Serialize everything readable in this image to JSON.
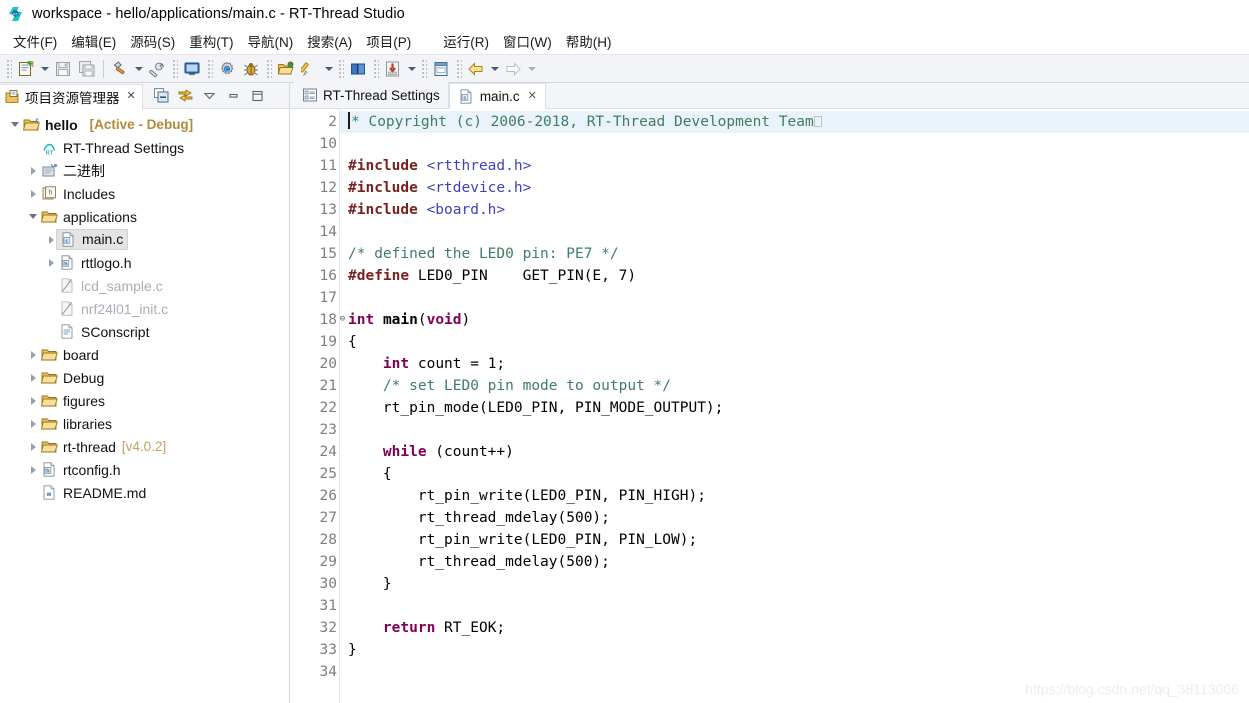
{
  "window": {
    "title": "workspace - hello/applications/main.c - RT-Thread Studio",
    "app_icon": "rt-thread-logo-icon"
  },
  "menubar": {
    "items": [
      {
        "label": "文件(F)",
        "name": "menu-file"
      },
      {
        "label": "编辑(E)",
        "name": "menu-edit"
      },
      {
        "label": "源码(S)",
        "name": "menu-source"
      },
      {
        "label": "重构(T)",
        "name": "menu-refactor"
      },
      {
        "label": "导航(N)",
        "name": "menu-navigate"
      },
      {
        "label": "搜索(A)",
        "name": "menu-search"
      },
      {
        "label": "项目(P)",
        "name": "menu-project"
      },
      {
        "label": "运行(R)",
        "name": "menu-run"
      },
      {
        "label": "窗口(W)",
        "name": "menu-window"
      },
      {
        "label": "帮助(H)",
        "name": "menu-help"
      }
    ]
  },
  "toolbar": {
    "buttons": [
      "new-file-icon",
      "save-icon",
      "save-all-icon",
      "build-hammer-icon",
      "wrench-icon",
      "console-icon",
      "settings-gear-icon",
      "debug-bug-icon",
      "open-folder-icon",
      "pencil-icon",
      "book-icon",
      "import-icon",
      "terminal-icon",
      "back-arrow-icon",
      "forward-arrow-icon"
    ]
  },
  "explorer": {
    "tab_label": "项目资源管理器",
    "tab_icon": "project-explorer-icon",
    "tab_close": "✕",
    "actions": [
      "collapse-all-icon",
      "link-with-editor-icon",
      "view-menu-icon",
      "minimize-icon",
      "maximize-icon"
    ],
    "tree": [
      {
        "label": "hello",
        "suffix": "[Active - Debug]",
        "icon": "c-project-folder-icon",
        "twist": "open",
        "depth": 0,
        "bold": true,
        "name": "tree-item-hello"
      },
      {
        "label": "RT-Thread Settings",
        "suffix": "",
        "icon": "rt-settings-icon",
        "twist": "none",
        "depth": 1,
        "bold": false,
        "name": "tree-item-rt-thread-settings"
      },
      {
        "label": "二进制",
        "suffix": "",
        "icon": "binaries-icon",
        "twist": "closed",
        "depth": 1,
        "bold": false,
        "name": "tree-item-binaries"
      },
      {
        "label": "Includes",
        "suffix": "",
        "icon": "includes-icon",
        "twist": "closed",
        "depth": 1,
        "bold": false,
        "name": "tree-item-includes"
      },
      {
        "label": "applications",
        "suffix": "",
        "icon": "folder-icon",
        "twist": "open",
        "depth": 1,
        "bold": false,
        "name": "tree-item-applications"
      },
      {
        "label": "main.c",
        "suffix": "",
        "icon": "c-file-icon",
        "twist": "closed",
        "depth": 2,
        "bold": false,
        "selected": true,
        "name": "tree-item-main-c"
      },
      {
        "label": "rttlogo.h",
        "suffix": "",
        "icon": "h-file-icon",
        "twist": "closed",
        "depth": 2,
        "bold": false,
        "name": "tree-item-rttlogo-h"
      },
      {
        "label": "lcd_sample.c",
        "suffix": "",
        "icon": "excluded-file-icon",
        "twist": "none",
        "depth": 2,
        "bold": false,
        "muted": true,
        "name": "tree-item-lcd-sample-c"
      },
      {
        "label": "nrf24l01_init.c",
        "suffix": "",
        "icon": "excluded-file-icon",
        "twist": "none",
        "depth": 2,
        "bold": false,
        "muted": true,
        "name": "tree-item-nrf24l01-init-c"
      },
      {
        "label": "SConscript",
        "suffix": "",
        "icon": "text-file-icon",
        "twist": "none",
        "depth": 2,
        "bold": false,
        "name": "tree-item-sconscript"
      },
      {
        "label": "board",
        "suffix": "",
        "icon": "folder-icon",
        "twist": "closed",
        "depth": 1,
        "bold": false,
        "name": "tree-item-board"
      },
      {
        "label": "Debug",
        "suffix": "",
        "icon": "folder-icon",
        "twist": "closed",
        "depth": 1,
        "bold": false,
        "name": "tree-item-debug"
      },
      {
        "label": "figures",
        "suffix": "",
        "icon": "folder-icon",
        "twist": "closed",
        "depth": 1,
        "bold": false,
        "name": "tree-item-figures"
      },
      {
        "label": "libraries",
        "suffix": "",
        "icon": "folder-icon",
        "twist": "closed",
        "depth": 1,
        "bold": false,
        "name": "tree-item-libraries"
      },
      {
        "label": "rt-thread",
        "suffix": "[v4.0.2]",
        "suffix_light": true,
        "icon": "folder-icon",
        "twist": "closed",
        "depth": 1,
        "bold": false,
        "name": "tree-item-rt-thread"
      },
      {
        "label": "rtconfig.h",
        "suffix": "",
        "icon": "h-file-icon",
        "twist": "closed",
        "depth": 1,
        "bold": false,
        "name": "tree-item-rtconfig-h"
      },
      {
        "label": "README.md",
        "suffix": "",
        "icon": "md-file-icon",
        "twist": "none",
        "depth": 1,
        "bold": false,
        "name": "tree-item-readme-md"
      }
    ]
  },
  "editor": {
    "tabs": [
      {
        "label": "RT-Thread Settings",
        "icon": "rt-settings-tab-icon",
        "active": false,
        "close": "",
        "name": "tab-rt-thread-settings"
      },
      {
        "label": "main.c",
        "icon": "c-file-icon",
        "active": true,
        "close": "✕",
        "name": "tab-main-c"
      }
    ],
    "line_numbers": [
      "2",
      "10",
      "11",
      "12",
      "13",
      "14",
      "15",
      "16",
      "17",
      "18",
      "19",
      "20",
      "21",
      "22",
      "23",
      "24",
      "25",
      "26",
      "27",
      "28",
      "29",
      "30",
      "31",
      "32",
      "33",
      "34"
    ],
    "fold_markers": {
      "2": "⊕",
      "18": "⊖"
    },
    "highlight_line": "2",
    "lines": [
      {
        "num": "2",
        "html": "<span class=\"cursor-bar\"></span><span class=\"cm\">* Copyright (c) 2006-2018, RT-Thread Development Team</span><span class=\"eol-box\"></span>"
      },
      {
        "num": "10",
        "html": ""
      },
      {
        "num": "11",
        "html": "<span class=\"pp\">#include</span> <span class=\"hh\">&lt;rtthread.h&gt;</span>"
      },
      {
        "num": "12",
        "html": "<span class=\"pp\">#include</span> <span class=\"hh\">&lt;rtdevice.h&gt;</span>"
      },
      {
        "num": "13",
        "html": "<span class=\"pp\">#include</span> <span class=\"hh\">&lt;board.h&gt;</span>"
      },
      {
        "num": "14",
        "html": ""
      },
      {
        "num": "15",
        "html": "<span class=\"cm\">/* defined the LED0 pin: PE7 */</span>"
      },
      {
        "num": "16",
        "html": "<span class=\"pp\">#define</span> LED0_PIN    GET_PIN(E, 7)"
      },
      {
        "num": "17",
        "html": ""
      },
      {
        "num": "18",
        "html": "<span class=\"k\">int</span> <span class=\"fn\">main</span>(<span class=\"k\">void</span>)"
      },
      {
        "num": "19",
        "html": "{"
      },
      {
        "num": "20",
        "html": "    <span class=\"k\">int</span> count = 1;"
      },
      {
        "num": "21",
        "html": "    <span class=\"cm\">/* set LED0 pin mode to output */</span>"
      },
      {
        "num": "22",
        "html": "    rt_pin_mode(LED0_PIN, PIN_MODE_OUTPUT);"
      },
      {
        "num": "23",
        "html": ""
      },
      {
        "num": "24",
        "html": "    <span class=\"k\">while</span> (count++)"
      },
      {
        "num": "25",
        "html": "    {"
      },
      {
        "num": "26",
        "html": "        rt_pin_write(LED0_PIN, PIN_HIGH);"
      },
      {
        "num": "27",
        "html": "        rt_thread_mdelay(500);"
      },
      {
        "num": "28",
        "html": "        rt_pin_write(LED0_PIN, PIN_LOW);"
      },
      {
        "num": "29",
        "html": "        rt_thread_mdelay(500);"
      },
      {
        "num": "30",
        "html": "    }"
      },
      {
        "num": "31",
        "html": ""
      },
      {
        "num": "32",
        "html": "    <span class=\"k\">return</span> RT_EOK;"
      },
      {
        "num": "33",
        "html": "}"
      },
      {
        "num": "34",
        "html": ""
      }
    ]
  },
  "watermark": {
    "text": "https://blog.csdn.net/qq_38113006"
  },
  "colors": {
    "keyword": "#7f0055",
    "preprocessor": "#7c2020",
    "include_header": "#4040c0",
    "comment": "#3f7f5f",
    "selection_line": "#eaf2fb",
    "active_project": "#b18a3a",
    "toolbar_bg": "#f3f4f8"
  }
}
